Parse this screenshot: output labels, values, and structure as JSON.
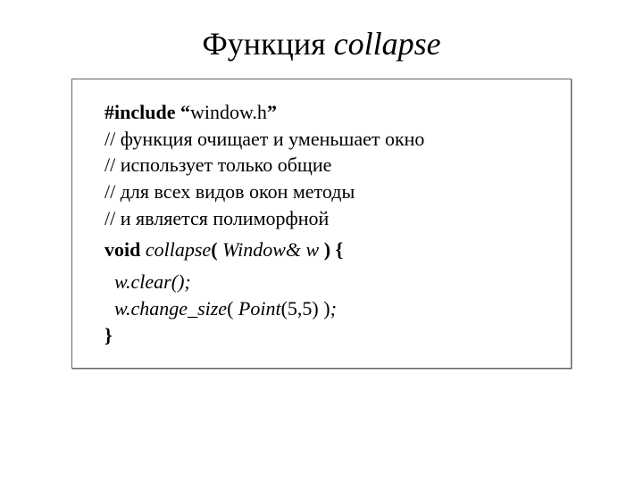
{
  "title": {
    "word1": "Функция ",
    "word2": "collapse"
  },
  "code": {
    "l1": {
      "a": "#include “",
      "b": "window.h",
      "c": "”"
    },
    "l2": "// функция очищает и уменьшает окно",
    "l3": "// использует только общие",
    "l4": "// для всех видов окон методы",
    "l5": "// и является полиморфной",
    "l6": {
      "a": "void ",
      "b": "collapse",
      "c": "( ",
      "d": "Window& w",
      "e": " ) {"
    },
    "l7": "  w.clear();",
    "l8": {
      "a": "  w.change_size",
      "b": "( ",
      "c": "Point",
      "d": "(5,5) )",
      "e": ";"
    },
    "l9": "}"
  }
}
